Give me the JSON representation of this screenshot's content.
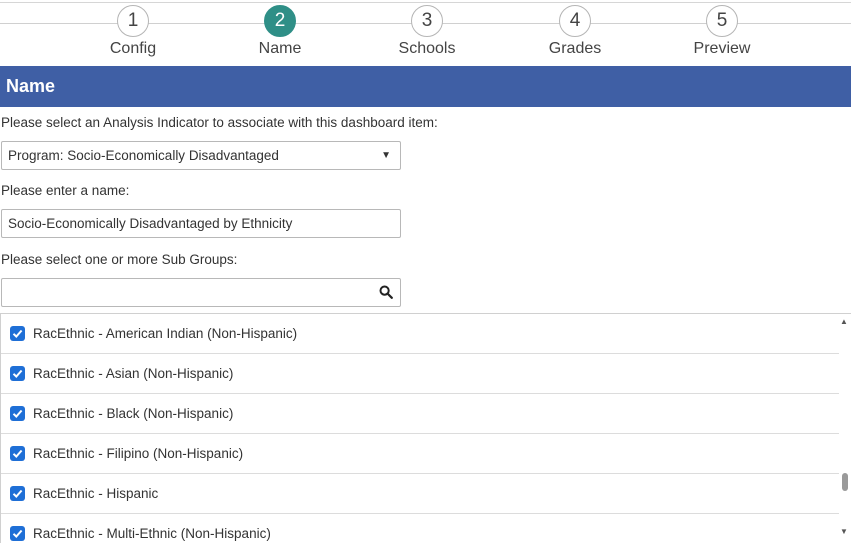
{
  "stepper": {
    "active_step": 2,
    "accent_color": "#2f8f87",
    "steps": [
      {
        "number": "1",
        "label": "Config"
      },
      {
        "number": "2",
        "label": "Name"
      },
      {
        "number": "3",
        "label": "Schools"
      },
      {
        "number": "4",
        "label": "Grades"
      },
      {
        "number": "5",
        "label": "Preview"
      }
    ]
  },
  "section": {
    "title": "Name",
    "color": "#3f5fa5"
  },
  "form": {
    "indicator_label": "Please select an Analysis Indicator to associate with this dashboard item:",
    "indicator_value": "Program: Socio-Economically Disadvantaged",
    "name_label": "Please enter a name:",
    "name_value": "Socio-Economically Disadvantaged by Ethnicity",
    "subgroups_label": "Please select one or more Sub Groups:",
    "search_value": ""
  },
  "subgroups": [
    {
      "label": "RacEthnic - American Indian (Non-Hispanic)",
      "checked": true
    },
    {
      "label": "RacEthnic - Asian (Non-Hispanic)",
      "checked": true
    },
    {
      "label": "RacEthnic - Black (Non-Hispanic)",
      "checked": true
    },
    {
      "label": "RacEthnic - Filipino (Non-Hispanic)",
      "checked": true
    },
    {
      "label": "RacEthnic - Hispanic",
      "checked": true
    },
    {
      "label": "RacEthnic - Multi-Ethnic (Non-Hispanic)",
      "checked": true
    }
  ],
  "icons": {
    "search": "search-icon",
    "dropdown": "chevron-down-icon",
    "checkbox": "checkmark-icon"
  }
}
